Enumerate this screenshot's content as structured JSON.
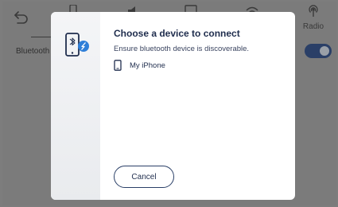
{
  "topbar": {
    "radio_label": "Radio"
  },
  "settings": {
    "bluetooth_label": "Bluetooth"
  },
  "dialog": {
    "title": "Choose a device to connect",
    "subtitle": "Ensure bluetooth device is discoverable.",
    "devices": [
      {
        "label": "My iPhone",
        "icon": "smartphone-icon"
      }
    ],
    "cancel_label": "Cancel"
  },
  "colors": {
    "overlay": "#7b7b7b",
    "accent_navy": "#2a3f67",
    "text_navy": "#1f2d4d",
    "bluetooth_badge": "#2f7fd8"
  }
}
